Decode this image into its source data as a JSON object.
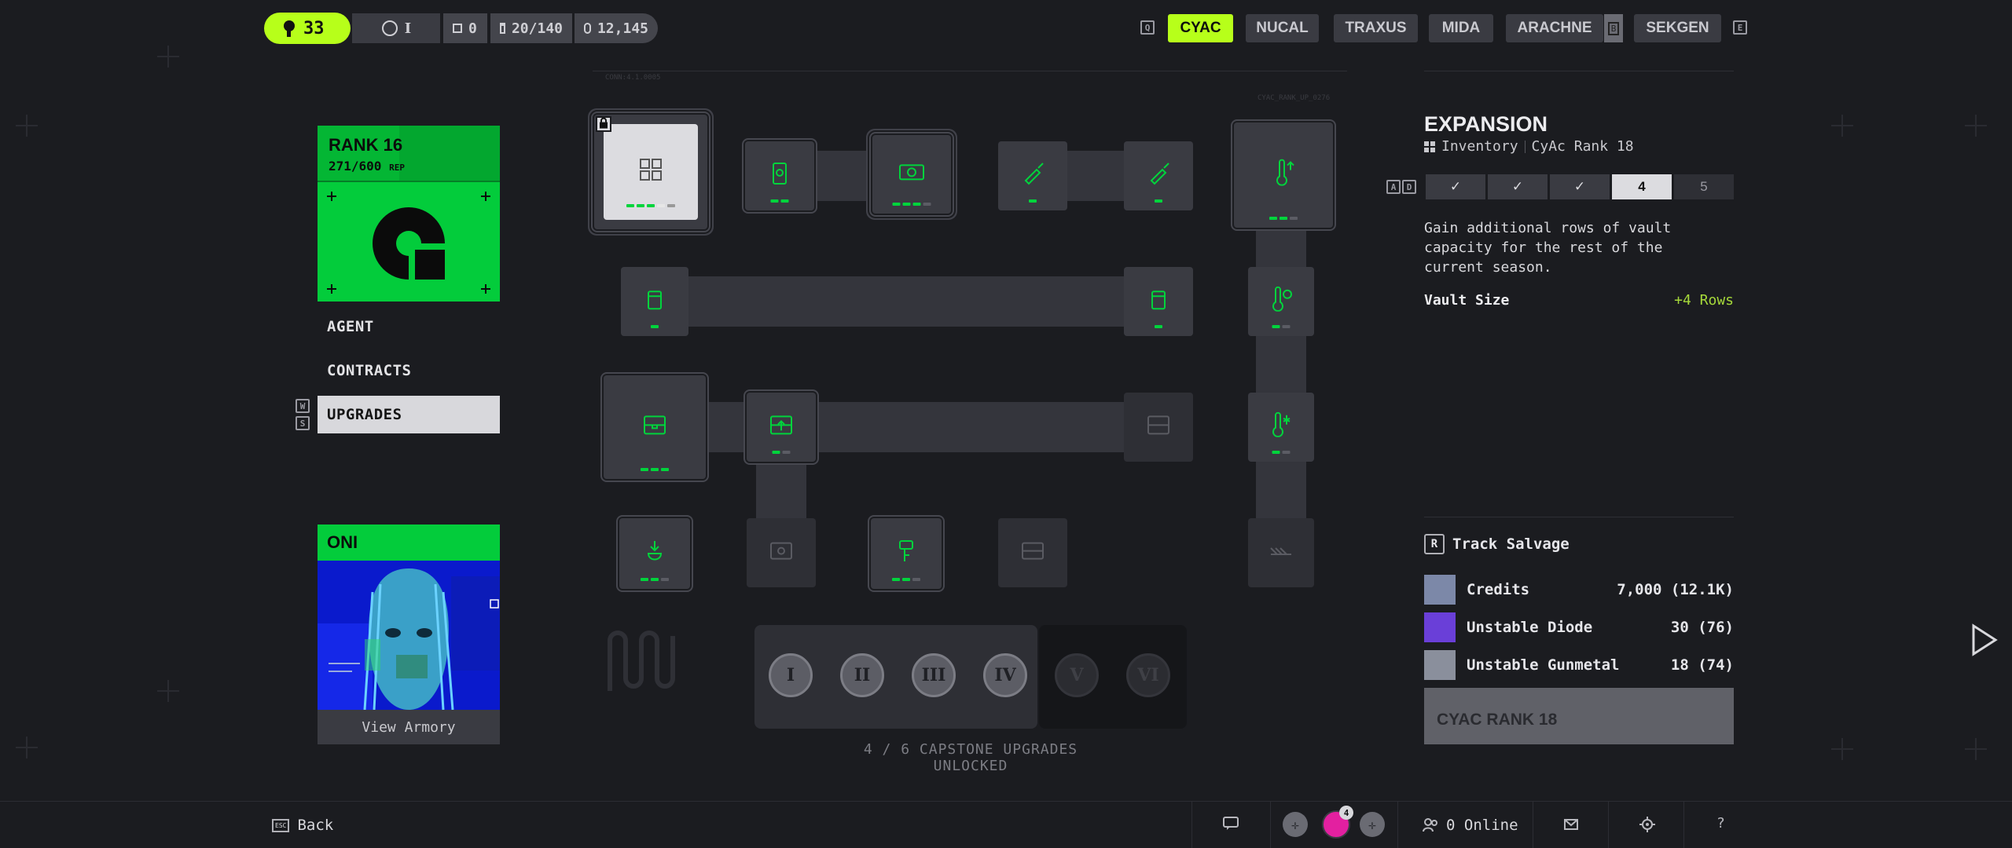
{
  "topbar": {
    "level": "33",
    "prestige": "I",
    "counter_a": "0",
    "vault": "20/140",
    "credits": "12,145",
    "key_left": "Q",
    "key_right": "E",
    "factions": [
      "CYAC",
      "NUCAL",
      "TRAXUS",
      "MIDA",
      "ARACHNE",
      "SEKGEN"
    ],
    "active_faction": "CYAC",
    "arachne_badge": "B"
  },
  "left": {
    "rank_title": "RANK 16",
    "rep": "271/600",
    "rep_unit": "REP",
    "menu": [
      "AGENT",
      "CONTRACTS",
      "UPGRADES"
    ],
    "menu_selected": "UPGRADES",
    "key_up": "W",
    "key_down": "S",
    "runner_name": "ONI",
    "view_armory": "View Armory"
  },
  "tree": {
    "capstones": [
      "I",
      "II",
      "III",
      "IV",
      "V",
      "VI"
    ],
    "capstone_status": "4 / 6 CAPSTONE UPGRADES UNLOCKED",
    "panel_caption_left": "CONN:4.1.0005",
    "panel_caption_right": "CYAC_RANK_UP_0276"
  },
  "detail": {
    "title": "EXPANSION",
    "category": "Inventory",
    "requirement": "CyAc Rank 18",
    "key_a": "A",
    "key_d": "D",
    "tiers": [
      "✓",
      "✓",
      "✓",
      "4",
      "5"
    ],
    "current_tier": "4",
    "description": "Gain additional rows of vault capacity for the rest of the current season.",
    "stat_label": "Vault Size",
    "stat_value": "+4 Rows",
    "track_key": "R",
    "track_label": "Track Salvage",
    "materials": [
      {
        "name": "Credits",
        "value": "7,000 (12.1K)"
      },
      {
        "name": "Unstable Diode",
        "value": "30 (76)"
      },
      {
        "name": "Unstable Gunmetal",
        "value": "18 (74)"
      }
    ],
    "unlock_button": "CYAC RANK 18"
  },
  "bottombar": {
    "back_key": "ESC",
    "back_label": "Back",
    "online": "0 Online",
    "notif_count": "4"
  },
  "colors": {
    "accent": "#b7ff1a",
    "node_green": "#00d43c",
    "rank_green": "#03cc3b",
    "stat_green": "#a6d93a",
    "background": "#1b1c20"
  }
}
